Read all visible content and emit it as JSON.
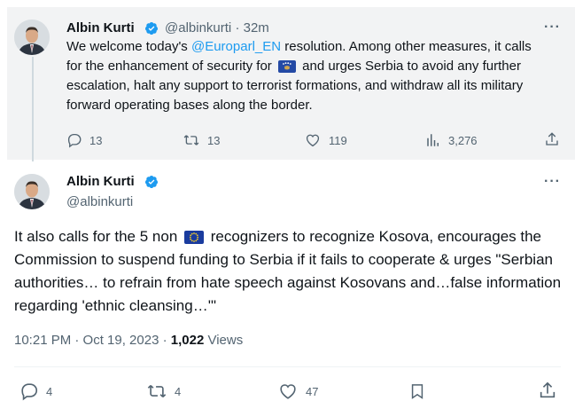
{
  "quoted_tweet": {
    "name": "Albin Kurti",
    "handle": "@albinkurti",
    "dot": "·",
    "time": "32m",
    "more": "···",
    "text_part1": "We welcome today's ",
    "mention": "@Europarl_EN",
    "text_part2": " resolution. Among other measures, it calls for the enhancement of security for ",
    "flag_icon": "kosovo-flag-icon",
    "text_part3": " and urges Serbia to avoid any further escalation, halt any support to terrorist formations, and withdraw all its military forward operating bases along the border.",
    "replies": "13",
    "reposts": "13",
    "likes": "119",
    "views": "3,276"
  },
  "main_tweet": {
    "name": "Albin Kurti",
    "handle": "@albinkurti",
    "more": "···",
    "text_part1": "It also calls for the 5 non ",
    "flag_icon": "eu-flag-icon",
    "text_part2": " recognizers to recognize Kosova, encourages the Commission to suspend funding to Serbia if it fails to cooperate & urges \"Serbian authorities… to refrain from hate speech against Kosovans and…false information regarding 'ethnic cleansing…'\"",
    "timestamp": "10:21 PM · Oct 19, 2023 · ",
    "views_count": "1,022",
    "views_label": " Views",
    "replies": "4",
    "reposts": "4",
    "likes": "47"
  },
  "colors": {
    "accent": "#1d9bf0",
    "secondary": "#536471",
    "context_bg": "#f2f3f4",
    "verified": "#1d9bf0"
  }
}
